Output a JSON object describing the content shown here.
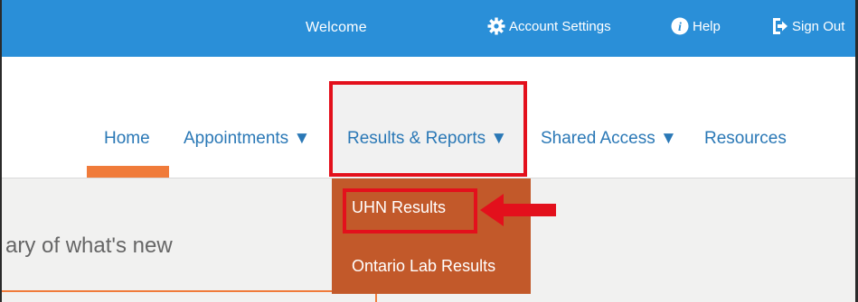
{
  "topbar": {
    "welcome": "Welcome",
    "account_settings": "Account Settings",
    "help": "Help",
    "sign_out": "Sign Out",
    "background_color": "#2a8fd8"
  },
  "nav": {
    "home": "Home",
    "appointments": "Appointments ▼",
    "results_reports": "Results & Reports ▼",
    "shared_access": "Shared Access ▼",
    "resources": "Resources",
    "active_item": "Home",
    "accent_color": "#f07b3a"
  },
  "dropdown": {
    "items": [
      "UHN Results",
      "Ontario Lab Results"
    ],
    "background_color": "#c2592a"
  },
  "content": {
    "summary_text": "ary of what's new"
  },
  "annotations": {
    "highlight_color": "#e3101c",
    "arrow_icon": "left-arrow-icon"
  }
}
